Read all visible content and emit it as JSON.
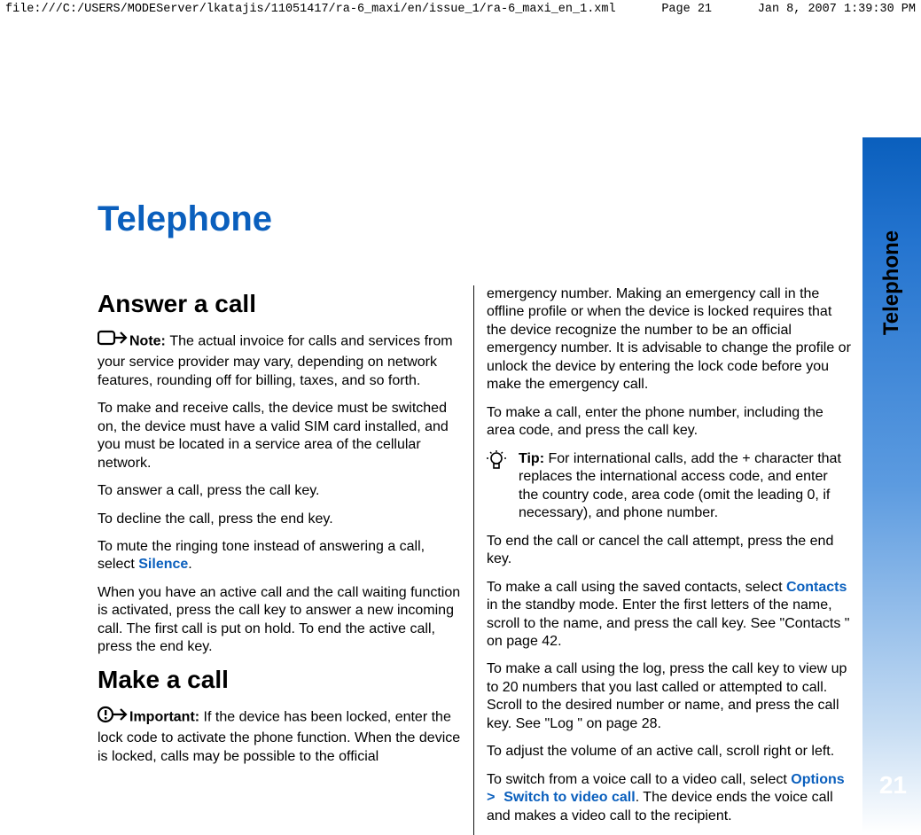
{
  "header": {
    "path": "file:///C:/USERS/MODEServer/lkatajis/11051417/ra-6_maxi/en/issue_1/ra-6_maxi_en_1.xml",
    "page": "Page 21",
    "date": "Jan 8, 2007 1:39:30 PM"
  },
  "sideTab": "Telephone",
  "pageNumber": "21",
  "title": "Telephone",
  "col1": {
    "h_answer": "Answer a call",
    "note_label": "Note:  ",
    "note_body": "The actual invoice for calls and services from your service provider may vary, depending on network features, rounding off for billing, taxes, and so forth.",
    "p2": "To make and receive calls, the device must be switched on, the device must have a valid SIM card installed, and you must be located in a service area of the cellular network.",
    "p3": "To answer a call, press the call key.",
    "p4": "To decline the call, press the end key.",
    "p5a": "To mute the ringing tone instead of answering a call, select ",
    "p5_kw": "Silence",
    "p5b": ".",
    "p6": "When you have an active call and the call waiting function is activated, press the call key to answer a new incoming call. The first call is put on hold. To end the active call, press the end key.",
    "h_make": "Make a call",
    "imp_label": "Important:  ",
    "imp_body": "If the device has been locked, enter the lock code to activate the phone function. When the device is locked, calls may be possible to the official"
  },
  "col2": {
    "p0": "emergency number. Making an emergency call in the offline profile or when the device is locked requires that the device recognize the number to be an official emergency number. It is advisable to change the profile or unlock the device by entering the lock code before you make the emergency call.",
    "p1": "To make a call, enter the phone number, including the area code, and press the call key.",
    "tip_label": "Tip:  ",
    "tip_body": "For international calls, add the + character that replaces the international access code, and enter the country code, area code (omit the leading 0, if necessary), and phone number.",
    "p3": "To end the call or cancel the call attempt, press the end key.",
    "p4a": "To make a call using the saved contacts, select ",
    "p4_kw": "Contacts",
    "p4b": " in the standby mode. Enter the first letters of the name, scroll to the name, and press the call key. See \"Contacts \" on page 42.",
    "p5": "To make a call using the log, press the call key to view up to 20 numbers that you last called or attempted to call. Scroll to the desired number or name, and press the call key. See \"Log \" on page 28.",
    "p6": "To adjust the volume of an active call, scroll right or left.",
    "p7a": "To switch from a voice call to a video call, select ",
    "p7_kw1": "Options",
    "p7_caret": " > ",
    "p7_kw2": "Switch to video call",
    "p7b": ". The device ends the voice call and makes a video call to the recipient."
  }
}
